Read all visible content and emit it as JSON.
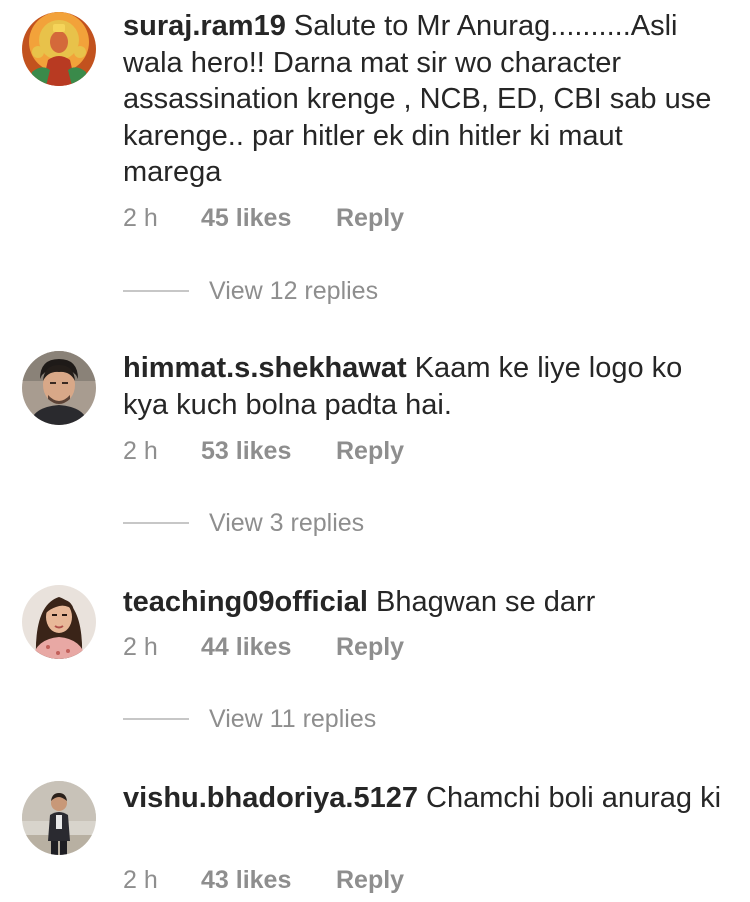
{
  "comments": [
    {
      "username": "suraj.ram19",
      "text": "Salute to Mr Anurag..........Asli wala hero!! Darna mat sir wo character assassination krenge , NCB, ED, CBI sab use karenge.. par hitler ek din hitler ki maut marega",
      "time": "2 h",
      "likes": "45 likes",
      "reply": "Reply",
      "view_replies": "View 12 replies",
      "avatar_icon": "deity-illustration-avatar"
    },
    {
      "username": "himmat.s.shekhawat",
      "text": "Kaam ke liye logo ko kya kuch bolna padta hai.",
      "time": "2 h",
      "likes": "53 likes",
      "reply": "Reply",
      "view_replies": "View 3 replies",
      "avatar_icon": "man-portrait-avatar"
    },
    {
      "username": "teaching09official",
      "text": "Bhagwan se darr",
      "time": "2 h",
      "likes": "44 likes",
      "reply": "Reply",
      "view_replies": "View 11 replies",
      "avatar_icon": "woman-portrait-avatar"
    },
    {
      "username": "vishu.bhadoriya.5127",
      "text": "Chamchi boli anurag ki",
      "time": "2 h",
      "likes": "43 likes",
      "reply": "Reply",
      "avatar_icon": "man-standing-avatar"
    }
  ],
  "colors": {
    "text": "#262626",
    "meta": "#8e8e8e",
    "divider": "#c7c7c7",
    "background": "#ffffff"
  }
}
